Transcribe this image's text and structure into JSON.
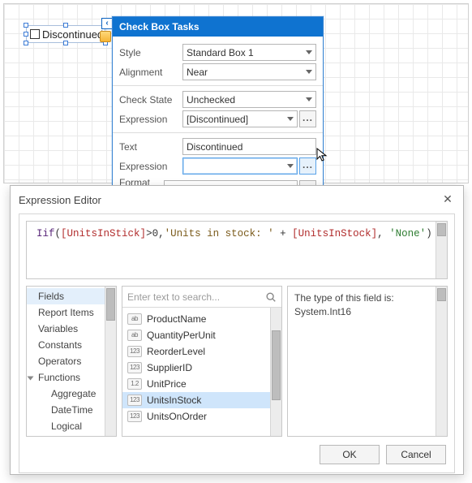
{
  "designer": {
    "checkbox_label": "Discontinued"
  },
  "smart_panel": {
    "title": "Check Box Tasks",
    "rows": {
      "style_label": "Style",
      "style_value": "Standard Box 1",
      "align_label": "Alignment",
      "align_value": "Near",
      "check_state_label": "Check State",
      "check_state_value": "Unchecked",
      "expr1_label": "Expression",
      "expr1_value": "[Discontinued]",
      "text_label": "Text",
      "text_value": "Discontinued",
      "expr2_label": "Expression",
      "expr2_value": "",
      "fmt_label": "Format String",
      "fmt_value": ""
    },
    "dots": "..."
  },
  "dialog": {
    "title": "Expression Editor",
    "close_glyph": "✕",
    "expression_tokens": {
      "fn": "Iif",
      "field1": "[UnitsInStick]",
      "op": ">0,",
      "str1": "'Units in stock: '",
      "plus": " + ",
      "field2": "[UnitsInStock]",
      "comma": ", ",
      "str2": "'None'"
    },
    "search_placeholder": "Enter text to search...",
    "categories": [
      {
        "label": "Fields",
        "selected": true
      },
      {
        "label": "Report Items"
      },
      {
        "label": "Variables"
      },
      {
        "label": "Constants"
      },
      {
        "label": "Operators"
      },
      {
        "label": "Functions",
        "expandable": true
      },
      {
        "label": "Aggregate",
        "sub": true
      },
      {
        "label": "DateTime",
        "sub": true
      },
      {
        "label": "Logical",
        "sub": true
      }
    ],
    "fields": [
      {
        "ico": "ab",
        "name": "ProductName"
      },
      {
        "ico": "ab",
        "name": "QuantityPerUnit"
      },
      {
        "ico": "123",
        "name": "ReorderLevel"
      },
      {
        "ico": "123",
        "name": "SupplierID"
      },
      {
        "ico": "1.2",
        "name": "UnitPrice"
      },
      {
        "ico": "123",
        "name": "UnitsInStock",
        "selected": true
      },
      {
        "ico": "123",
        "name": "UnitsOnOrder"
      }
    ],
    "description_line1": "The type of this field is:",
    "description_line2": "System.Int16",
    "ok_label": "OK",
    "cancel_label": "Cancel"
  }
}
